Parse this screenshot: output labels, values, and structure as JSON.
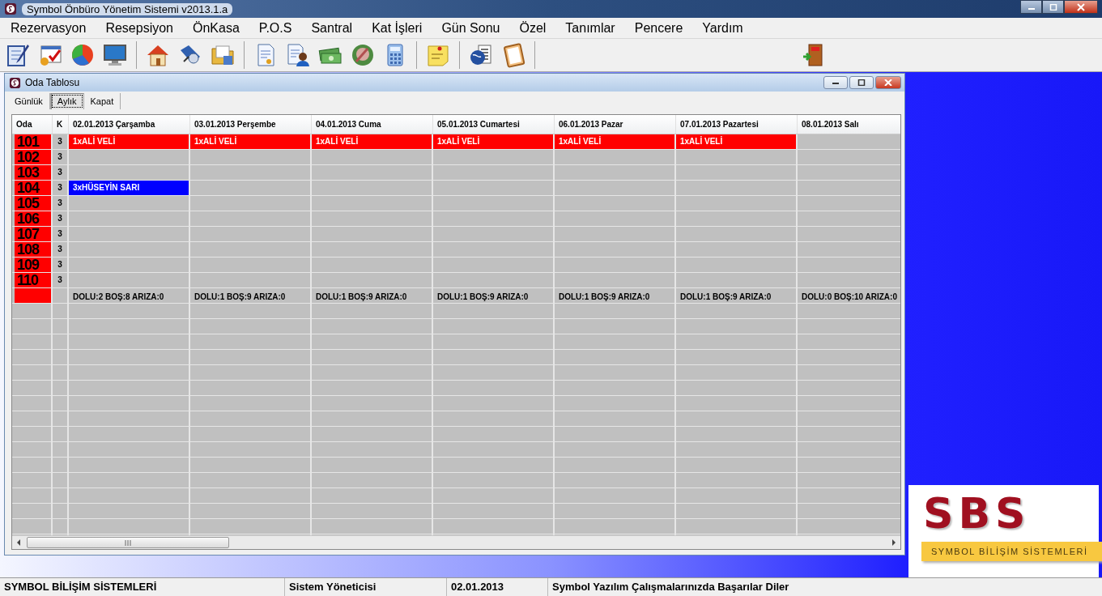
{
  "window": {
    "title": "Symbol Önbüro Yönetim Sistemi v2013.1.a"
  },
  "menu": [
    "Rezervasyon",
    "Resepsiyon",
    "ÖnKasa",
    "P.O.S",
    "Santral",
    "Kat İşleri",
    "Gün Sonu",
    "Özel",
    "Tanımlar",
    "Pencere",
    "Yardım"
  ],
  "child_window": {
    "title": "Oda Tablosu",
    "tabs": [
      {
        "label": "Günlük",
        "selected": false
      },
      {
        "label": "Aylık",
        "selected": true
      },
      {
        "label": "Kapat",
        "selected": false
      }
    ],
    "table": {
      "columns": [
        "Oda",
        "K",
        "02.01.2013 Çarşamba",
        "03.01.2013 Perşembe",
        "04.01.2013 Cuma",
        "05.01.2013 Cumartesi",
        "06.01.2013 Pazar",
        "07.01.2013 Pazartesi",
        "08.01.2013 Salı"
      ],
      "rows": [
        {
          "cells": [
            {
              "kind": "room",
              "text": "101",
              "color": "#ff0000"
            },
            {
              "kind": "capacity",
              "text": "3"
            },
            {
              "kind": "booking",
              "text": "1xALİ VELİ",
              "color": "#ff0000"
            },
            {
              "kind": "booking",
              "text": "1xALİ VELİ",
              "color": "#ff0000"
            },
            {
              "kind": "booking",
              "text": "1xALİ VELİ",
              "color": "#ff0000"
            },
            {
              "kind": "booking",
              "text": "1xALİ VELİ",
              "color": "#ff0000"
            },
            {
              "kind": "booking",
              "text": "1xALİ VELİ",
              "color": "#ff0000"
            },
            {
              "kind": "booking",
              "text": "1xALİ VELİ",
              "color": "#ff0000"
            },
            {
              "kind": "booking"
            }
          ]
        },
        {
          "cells": [
            {
              "kind": "room",
              "text": "102",
              "color": "#ff0000"
            },
            {
              "kind": "capacity",
              "text": "3"
            },
            {
              "kind": "booking"
            },
            {
              "kind": "booking"
            },
            {
              "kind": "booking"
            },
            {
              "kind": "booking"
            },
            {
              "kind": "booking"
            },
            {
              "kind": "booking"
            },
            {
              "kind": "booking"
            }
          ]
        },
        {
          "cells": [
            {
              "kind": "room",
              "text": "103",
              "color": "#ff0000"
            },
            {
              "kind": "capacity",
              "text": "3"
            },
            {
              "kind": "booking"
            },
            {
              "kind": "booking"
            },
            {
              "kind": "booking"
            },
            {
              "kind": "booking"
            },
            {
              "kind": "booking"
            },
            {
              "kind": "booking"
            },
            {
              "kind": "booking"
            }
          ]
        },
        {
          "cells": [
            {
              "kind": "room",
              "text": "104",
              "color": "#ff0000"
            },
            {
              "kind": "capacity",
              "text": "3"
            },
            {
              "kind": "booking",
              "text": "3xHÜSEYİN SARI",
              "color": "#0000ff"
            },
            {
              "kind": "booking"
            },
            {
              "kind": "booking"
            },
            {
              "kind": "booking"
            },
            {
              "kind": "booking"
            },
            {
              "kind": "booking"
            },
            {
              "kind": "booking"
            }
          ]
        },
        {
          "cells": [
            {
              "kind": "room",
              "text": "105",
              "color": "#ff0000"
            },
            {
              "kind": "capacity",
              "text": "3"
            },
            {
              "kind": "booking"
            },
            {
              "kind": "booking"
            },
            {
              "kind": "booking"
            },
            {
              "kind": "booking"
            },
            {
              "kind": "booking"
            },
            {
              "kind": "booking"
            },
            {
              "kind": "booking"
            }
          ]
        },
        {
          "cells": [
            {
              "kind": "room",
              "text": "106",
              "color": "#ff0000"
            },
            {
              "kind": "capacity",
              "text": "3"
            },
            {
              "kind": "booking"
            },
            {
              "kind": "booking"
            },
            {
              "kind": "booking"
            },
            {
              "kind": "booking"
            },
            {
              "kind": "booking"
            },
            {
              "kind": "booking"
            },
            {
              "kind": "booking"
            }
          ]
        },
        {
          "cells": [
            {
              "kind": "room",
              "text": "107",
              "color": "#ff0000"
            },
            {
              "kind": "capacity",
              "text": "3"
            },
            {
              "kind": "booking"
            },
            {
              "kind": "booking"
            },
            {
              "kind": "booking"
            },
            {
              "kind": "booking"
            },
            {
              "kind": "booking"
            },
            {
              "kind": "booking"
            },
            {
              "kind": "booking"
            }
          ]
        },
        {
          "cells": [
            {
              "kind": "room",
              "text": "108",
              "color": "#ff0000"
            },
            {
              "kind": "capacity",
              "text": "3"
            },
            {
              "kind": "booking"
            },
            {
              "kind": "booking"
            },
            {
              "kind": "booking"
            },
            {
              "kind": "booking"
            },
            {
              "kind": "booking"
            },
            {
              "kind": "booking"
            },
            {
              "kind": "booking"
            }
          ]
        },
        {
          "cells": [
            {
              "kind": "room",
              "text": "109",
              "color": "#ff0000"
            },
            {
              "kind": "capacity",
              "text": "3"
            },
            {
              "kind": "booking"
            },
            {
              "kind": "booking"
            },
            {
              "kind": "booking"
            },
            {
              "kind": "booking"
            },
            {
              "kind": "booking"
            },
            {
              "kind": "booking"
            },
            {
              "kind": "booking"
            }
          ]
        },
        {
          "cells": [
            {
              "kind": "room",
              "text": "110",
              "color": "#ff0000"
            },
            {
              "kind": "capacity",
              "text": "3"
            },
            {
              "kind": "booking"
            },
            {
              "kind": "booking"
            },
            {
              "kind": "booking"
            },
            {
              "kind": "booking"
            },
            {
              "kind": "booking"
            },
            {
              "kind": "booking"
            },
            {
              "kind": "booking"
            }
          ]
        },
        {
          "cells": [
            {
              "kind": "room",
              "color": "#ff0000"
            },
            {
              "kind": "capacity"
            },
            {
              "kind": "summary",
              "text": "DOLU:2 BOŞ:8 ARIZA:0"
            },
            {
              "kind": "summary",
              "text": "DOLU:1 BOŞ:9 ARIZA:0"
            },
            {
              "kind": "summary",
              "text": "DOLU:1 BOŞ:9 ARIZA:0"
            },
            {
              "kind": "summary",
              "text": "DOLU:1 BOŞ:9 ARIZA:0"
            },
            {
              "kind": "summary",
              "text": "DOLU:1 BOŞ:9 ARIZA:0"
            },
            {
              "kind": "summary",
              "text": "DOLU:1 BOŞ:9 ARIZA:0"
            },
            {
              "kind": "summary",
              "text": "DOLU:0 BOŞ:10 ARIZA:0"
            }
          ]
        }
      ]
    }
  },
  "logo": {
    "mark": "SBS",
    "tagline": "SYMBOL BİLİŞİM SİSTEMLERİ"
  },
  "status_bar": [
    "SYMBOL BİLİŞİM SİSTEMLERİ",
    "Sistem Yöneticisi",
    "02.01.2013",
    "Symbol Yazılım Çalışmalarınızda Başarılar Diler"
  ]
}
